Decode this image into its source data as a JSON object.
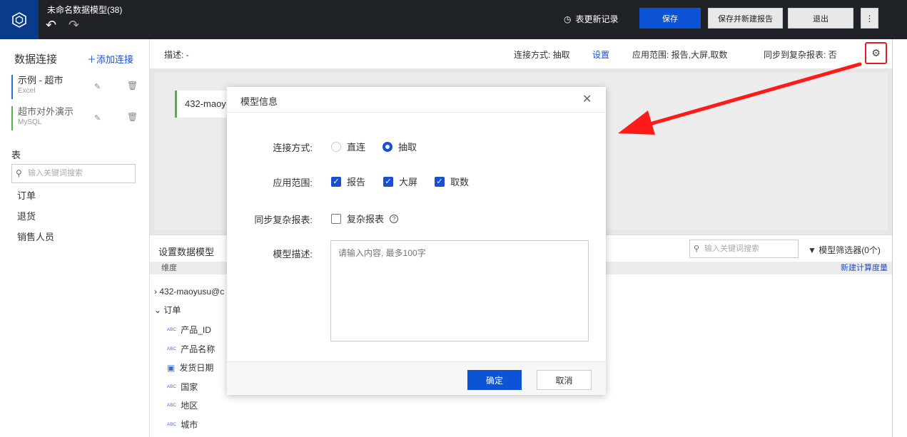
{
  "app": {
    "title": "未命名数据模型(38)",
    "record_label": "表更新记录",
    "save": "保存",
    "save_new_report": "保存并新建报告",
    "exit": "退出",
    "more": "⋮"
  },
  "sidebar": {
    "heading": "数据连接",
    "add_connection": "添加连接",
    "connections": [
      {
        "name": "示例 - 超市",
        "type": "Excel"
      },
      {
        "name": "超市对外演示",
        "type": "MySQL"
      }
    ],
    "tables_heading": "表",
    "search_placeholder": "输入关键词搜索",
    "tables": [
      "订单",
      "退货",
      "销售人员"
    ]
  },
  "infobar": {
    "description": "描述: -",
    "connection_mode": "连接方式: 抽取",
    "settings": "设置",
    "scope": "应用范围: 报告,大屏,取数",
    "sync": "同步到复杂报表: 否"
  },
  "canvas": {
    "table_card": "432-maoy"
  },
  "model": {
    "label": "设置数据模型",
    "search_placeholder": "输入关键词搜索",
    "filter": "模型筛选器(0个)",
    "dimension_header": "维度",
    "new_measure": "新建计算度量",
    "tree_root": "432-maoyusu@c",
    "tree_table": "订单",
    "fields": [
      {
        "icon": "abc",
        "name": "产品_ID"
      },
      {
        "icon": "abc",
        "name": "产品名称"
      },
      {
        "icon": "calendar",
        "name": "发货日期"
      },
      {
        "icon": "abc",
        "name": "国家"
      },
      {
        "icon": "abc",
        "name": "地区"
      },
      {
        "icon": "abc",
        "name": "城市"
      }
    ]
  },
  "modal": {
    "title": "模型信息",
    "conn_label": "连接方式:",
    "opt_direct": "直连",
    "opt_extract": "抽取",
    "scope_label": "应用范围:",
    "opt_report": "报告",
    "opt_screen": "大屏",
    "opt_fetch": "取数",
    "sync_label": "同步复杂报表:",
    "opt_complex": "复杂报表",
    "desc_label": "模型描述:",
    "desc_placeholder": "请输入内容, 最多100字",
    "ok": "确定",
    "cancel": "取消"
  },
  "colors": {
    "topbar": "#1f2328",
    "primary": "#0c53d6",
    "link": "#1a4fd1",
    "highlight_box": "#e02020",
    "arrow": "#ff1a1a"
  }
}
